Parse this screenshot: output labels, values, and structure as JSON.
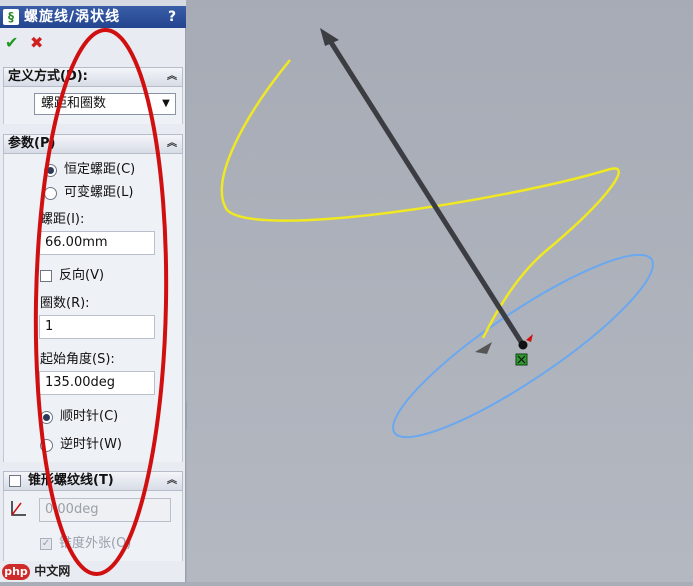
{
  "window": {
    "title": "螺旋线/涡状线",
    "help": "?"
  },
  "actions": {
    "ok_icon": "checkmark-icon",
    "cancel_icon": "x-icon"
  },
  "definition": {
    "header": "定义方式(D):",
    "selected": "螺距和圈数"
  },
  "parameters": {
    "header": "参数(P)",
    "radio_constant": "恒定螺距(C)",
    "radio_variable": "可变螺距(L)",
    "pitch_label": "螺距(I):",
    "pitch_value": "66.00mm",
    "reverse_label": "反向(V)",
    "revolutions_label": "圈数(R):",
    "revolutions_value": "1",
    "start_angle_label": "起始角度(S):",
    "start_angle_value": "135.00deg",
    "radio_clockwise": "顺时针(C)",
    "radio_counterclockwise": "逆时针(W)"
  },
  "taper": {
    "header": "锥形螺纹线(T)",
    "angle_value": "0.00deg",
    "outward_label": "锥度外张(O)"
  },
  "watermark": {
    "logo_text": "php",
    "text": "中文网"
  },
  "colors": {
    "helix": "#f0e821",
    "ellipse": "#6aa8f0",
    "annotation": "#d01010",
    "axis": "#3b3d42"
  }
}
